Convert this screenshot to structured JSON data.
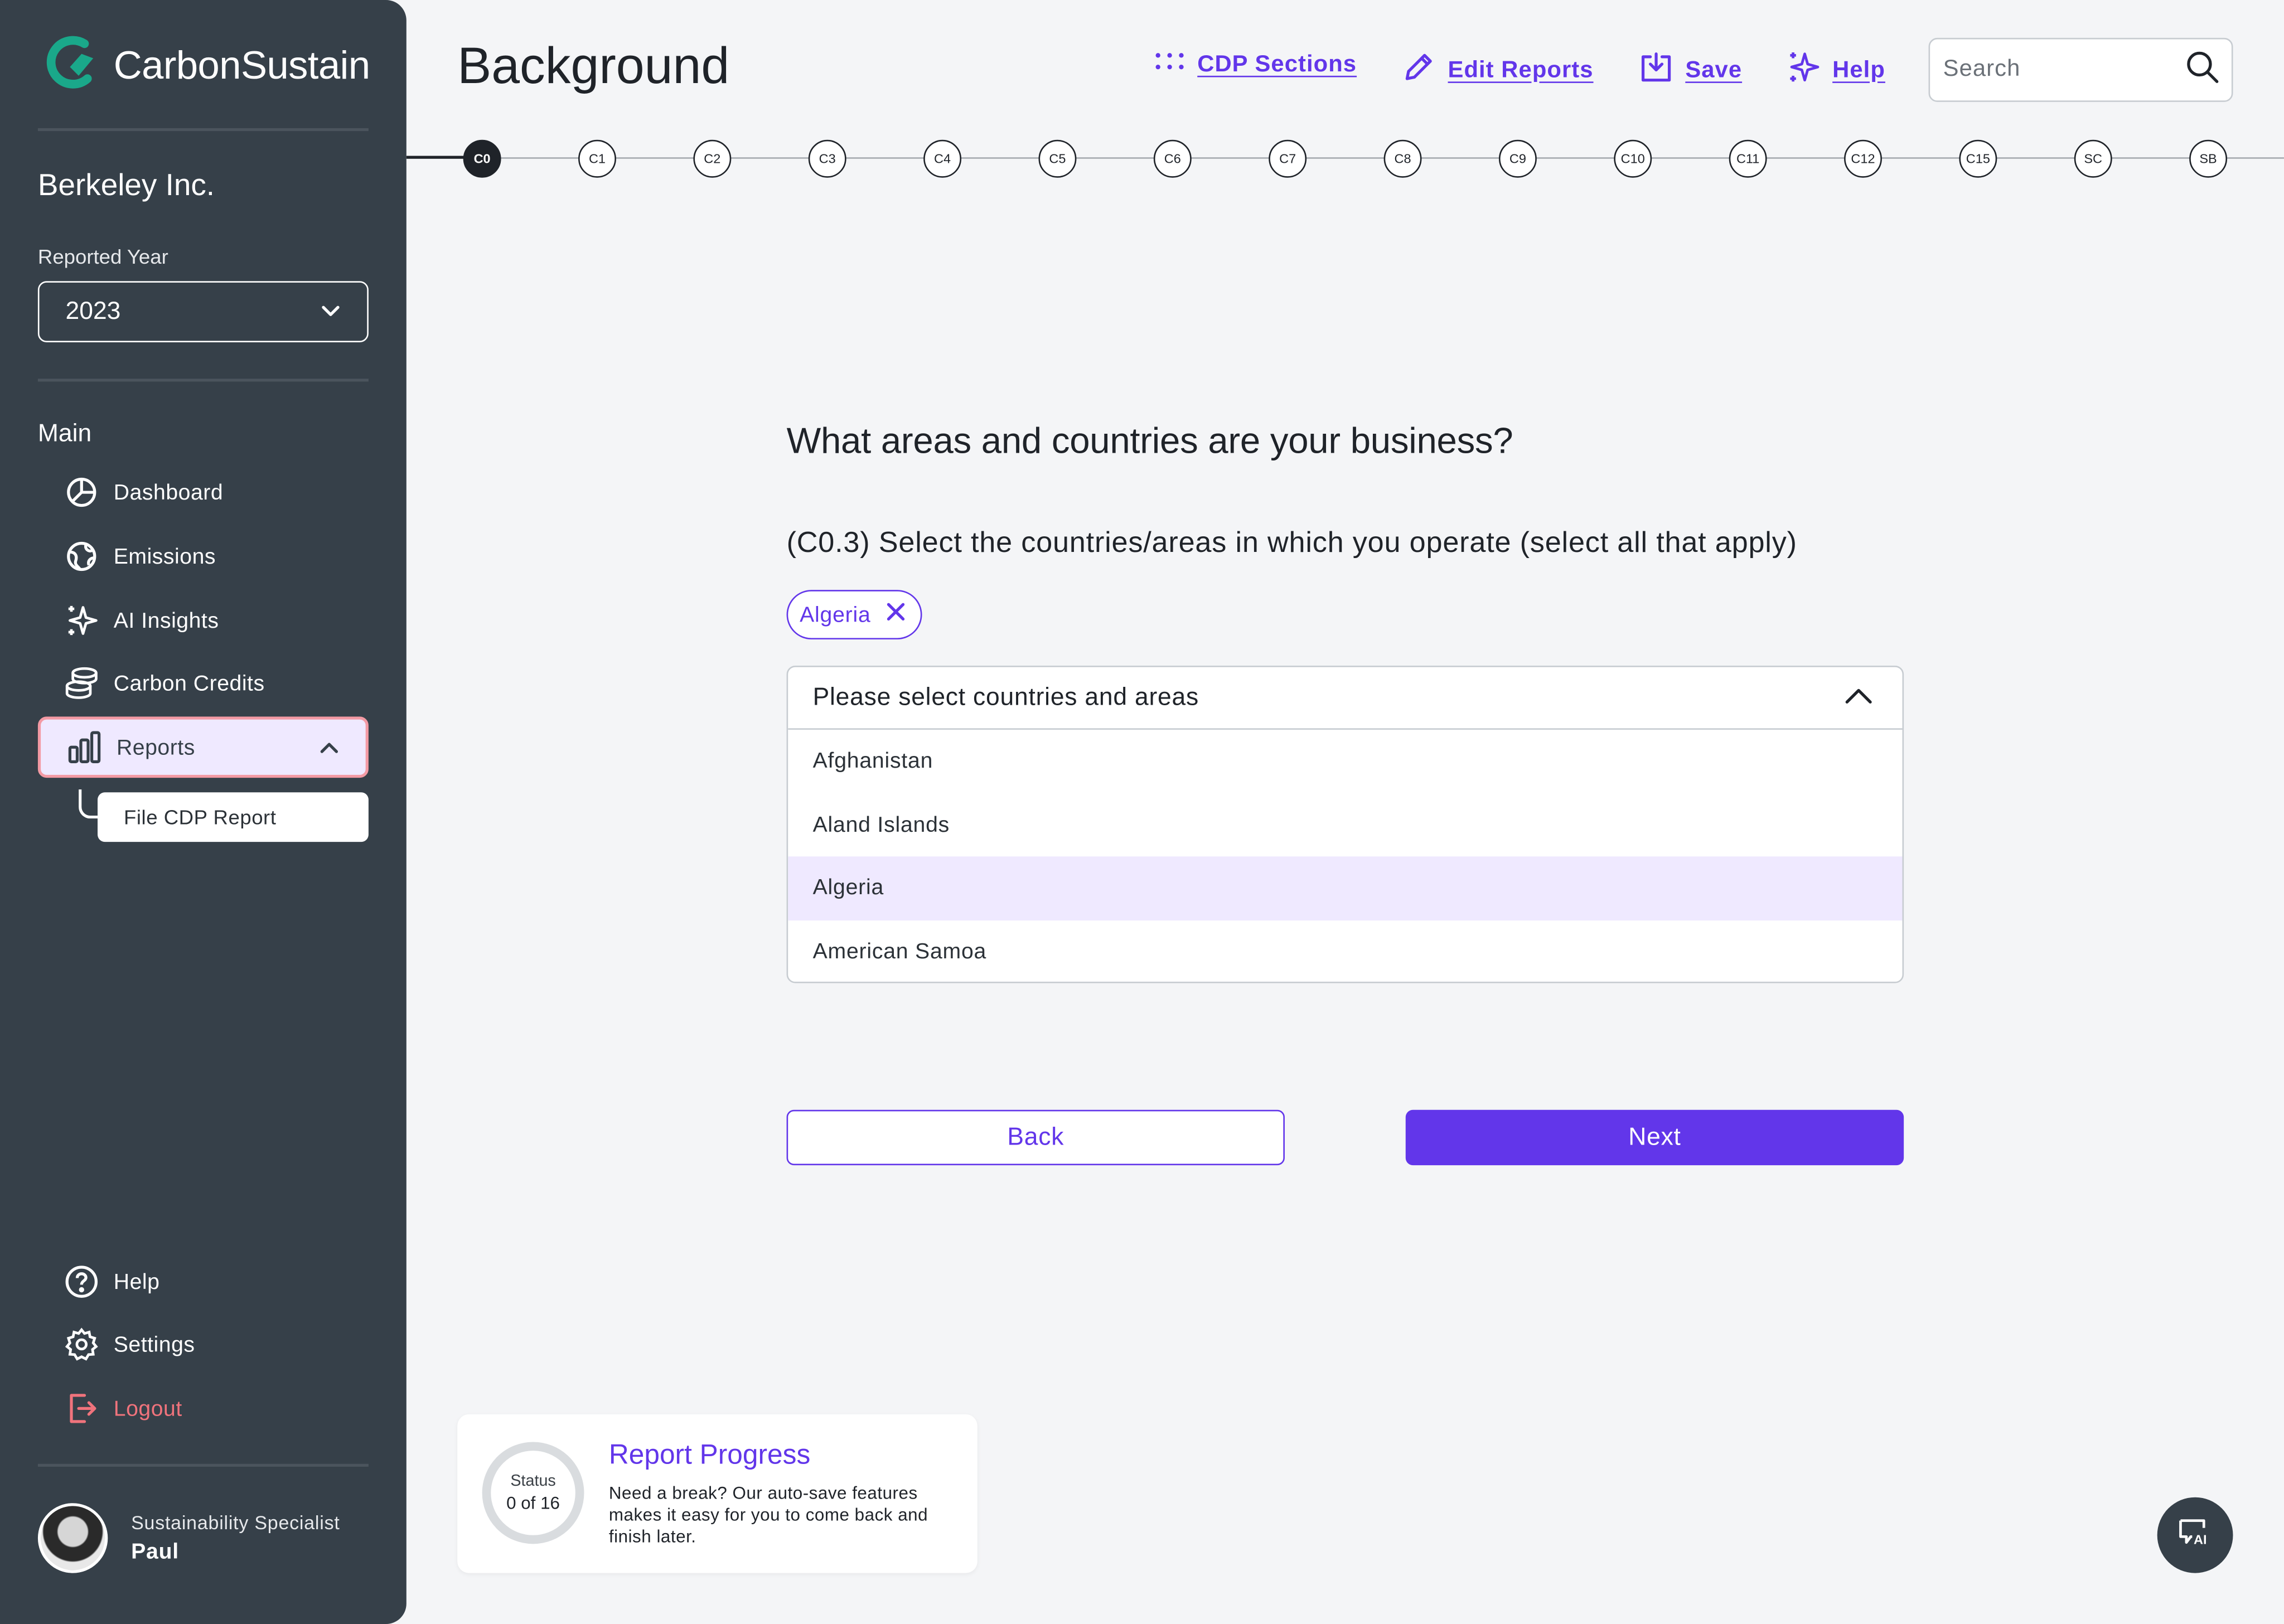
{
  "brand": {
    "name": "CarbonSustain"
  },
  "company": "Berkeley Inc.",
  "reported_year": {
    "label": "Reported Year",
    "value": "2023"
  },
  "sidebar": {
    "main_label": "Main",
    "items": [
      {
        "label": "Dashboard",
        "icon": "pie-chart-icon"
      },
      {
        "label": "Emissions",
        "icon": "globe-icon"
      },
      {
        "label": "AI Insights",
        "icon": "sparkle-icon"
      },
      {
        "label": "Carbon Credits",
        "icon": "coins-icon"
      },
      {
        "label": "Reports",
        "icon": "bar-chart-icon",
        "active": true
      }
    ],
    "sub_items": [
      {
        "label": "File CDP Report"
      }
    ],
    "bottom_items": [
      {
        "label": "Help",
        "icon": "question-icon"
      },
      {
        "label": "Settings",
        "icon": "gear-icon"
      },
      {
        "label": "Logout",
        "icon": "logout-icon"
      }
    ]
  },
  "user": {
    "role": "Sustainability Specialist",
    "name": "Paul"
  },
  "header": {
    "title": "Background",
    "actions": {
      "cdp_sections": "CDP Sections",
      "edit_reports": "Edit Reports",
      "save": "Save",
      "help": "Help"
    },
    "search": {
      "placeholder": "Search",
      "value": ""
    }
  },
  "stepper": {
    "steps": [
      "C0",
      "C1",
      "C2",
      "C3",
      "C4",
      "C5",
      "C6",
      "C7",
      "C8",
      "C9",
      "C10",
      "C11",
      "C12",
      "C15",
      "SC",
      "SB"
    ],
    "current": "C0"
  },
  "question": {
    "title": "What areas and countries are your business?",
    "subtitle": "(C0.3) Select the countries/areas in which you operate (select all that apply)",
    "selected_chips": [
      "Algeria"
    ],
    "dropdown": {
      "placeholder": "Please select countries and areas",
      "options": [
        "Afghanistan",
        "Aland Islands",
        "Algeria",
        "American Samoa"
      ],
      "highlighted": "Algeria"
    }
  },
  "buttons": {
    "back": "Back",
    "next": "Next"
  },
  "progress_card": {
    "title": "Report Progress",
    "status_label": "Status",
    "status_value": "0 of 16",
    "text": "Need a break? Our auto-save features makes it easy for you to come back and finish later."
  },
  "colors": {
    "accent": "#6236ea",
    "sidebar": "#364049",
    "brand_teal": "#1aa88a",
    "logout": "#f0737c"
  }
}
